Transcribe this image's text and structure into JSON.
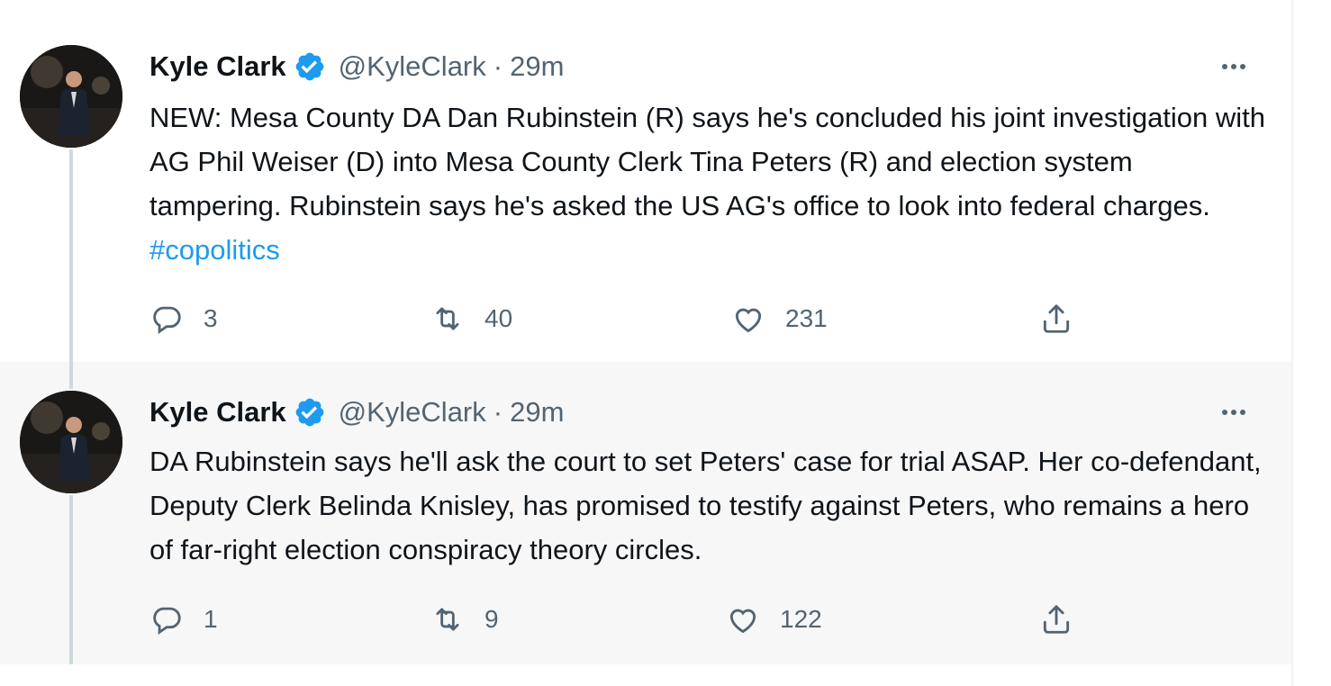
{
  "tweets": [
    {
      "name": "Kyle Clark",
      "handle": "@KyleClark",
      "separator": "·",
      "time": "29m",
      "text": "NEW: Mesa County DA Dan Rubinstein (R) says he's concluded his joint investigation with AG Phil Weiser (D) into Mesa County Clerk Tina Peters (R) and election system tampering. Rubinstein says he's asked the US AG's office to look into federal charges.",
      "hashtag": "#copolitics",
      "replies": "3",
      "retweets": "40",
      "likes": "231"
    },
    {
      "name": "Kyle Clark",
      "handle": "@KyleClark",
      "separator": "·",
      "time": "29m",
      "text": "DA Rubinstein says he'll ask the court to set Peters' case for trial ASAP. Her co-defendant, Deputy Clerk Belinda Knisley, has promised to testify against Peters, who remains a hero of far-right election conspiracy theory circles.",
      "replies": "1",
      "retweets": "9",
      "likes": "122"
    }
  ],
  "colors": {
    "verified": "#1d9bf0",
    "hashtag": "#1d9bf0",
    "muted": "#536471",
    "text": "#0f1419",
    "highlight_bg": "#f7f7f7",
    "thread_line": "#cfd9de"
  },
  "icons": [
    "verified-badge-icon",
    "more-icon",
    "reply-icon",
    "retweet-icon",
    "like-icon",
    "share-icon"
  ]
}
